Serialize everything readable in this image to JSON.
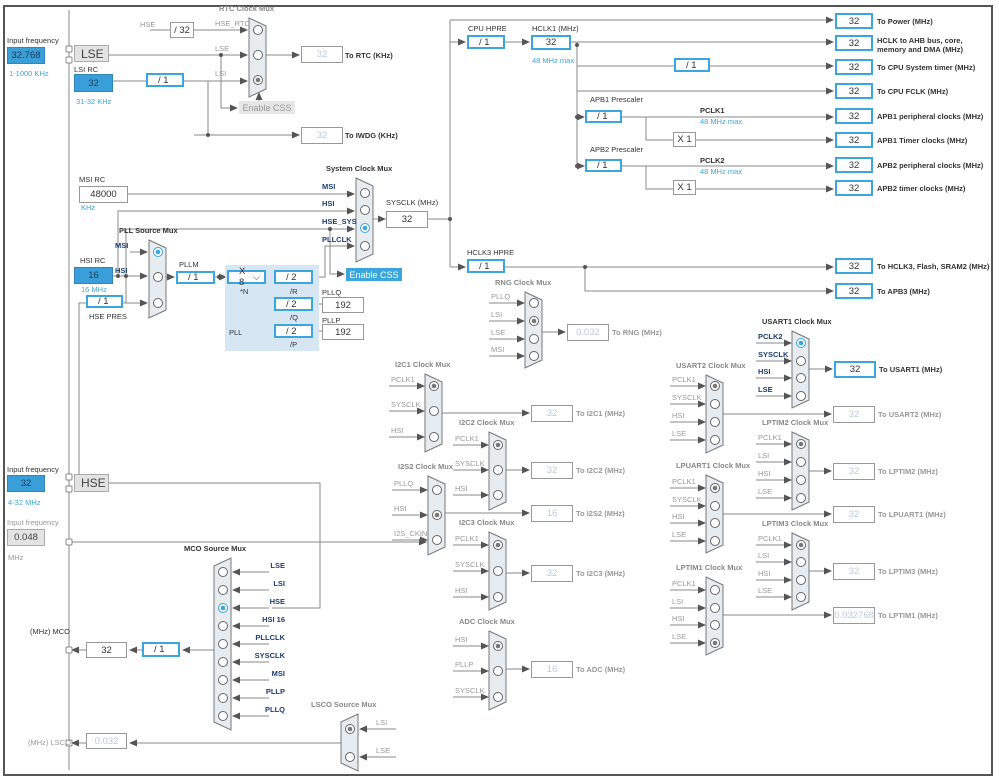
{
  "inputs": {
    "lse_freq": {
      "label": "Input frequency",
      "value": "32.768",
      "range": "1-1000 KHz"
    },
    "lse": "LSE",
    "lsi_rc": {
      "label": "LSI RC",
      "value": "32",
      "range": "31-32 KHz"
    },
    "msi_rc": {
      "label": "MSI RC",
      "value": "48000",
      "unit": "KHz"
    },
    "hsi_rc": {
      "label": "HSI RC",
      "value": "16",
      "range": "16 MHz"
    },
    "hse_freq": {
      "label": "Input frequency",
      "value": "32",
      "range": "4-32 MHz"
    },
    "hse": "HSE",
    "i2s_freq": {
      "label": "Input frequency",
      "value": "0.048",
      "unit": "MHz"
    }
  },
  "rtc": {
    "hse_label": "HSE",
    "hse_div": "/ 32",
    "lsi_div": "/ 1",
    "enable_css": "Enable CSS",
    "to_rtc": {
      "value": "32",
      "label": "To RTC (KHz)"
    },
    "to_iwdg": {
      "value": "32",
      "label": "To IWDG (KHz)"
    }
  },
  "pll": {
    "hse_pres": "/ 1",
    "hse_pres_label": "HSE PRES",
    "pllm_label": "PLLM",
    "pllm": "/ 1",
    "n_mult": "X 8",
    "n_label": "*N",
    "r_div": "/ 2",
    "r_label": "/R",
    "q_div": "/ 2",
    "q_label": "/Q",
    "p_div": "/ 2",
    "p_label": "/P",
    "region_label": "PLL",
    "pllq_label": "PLLQ",
    "pllq": "192",
    "pllp_label": "PLLP",
    "pllp": "192",
    "enable_css": "Enable CSS"
  },
  "sysclk": {
    "label": "SYSCLK (MHz)",
    "value": "32"
  },
  "bus": {
    "cpu_hpre_label": "CPU HPRE",
    "cpu_hpre": "/ 1",
    "hclk1_label": "HCLK1 (MHz)",
    "hclk1": "32",
    "hclk1_max": "48 MHz max",
    "systick_div": "/ 1",
    "apb1_label": "APB1 Prescaler",
    "apb1": "/ 1",
    "pclk1_label": "PCLK1",
    "pclk1_max": "48 MHz max",
    "apb1_timer_mult": "X 1",
    "apb2_label": "APB2 Prescaler",
    "apb2": "/ 1",
    "pclk2_label": "PCLK2",
    "pclk2_max": "48 MHz max",
    "apb2_timer_mult": "X 1",
    "hclk3_label": "HCLK3 HPRE",
    "hclk3": "/ 1"
  },
  "bus_outputs": [
    {
      "value": "32",
      "label": "To Power (MHz)"
    },
    {
      "value": "32",
      "label": "HCLK to AHB bus, core, memory and DMA (MHz)"
    },
    {
      "value": "32",
      "label": "To CPU System timer (MHz)"
    },
    {
      "value": "32",
      "label": "To CPU FCLK (MHz)"
    },
    {
      "value": "32",
      "label": "APB1 peripheral clocks (MHz)"
    },
    {
      "value": "32",
      "label": "APB1 Timer clocks (MHz)"
    },
    {
      "value": "32",
      "label": "APB2 peripheral clocks (MHz)"
    },
    {
      "value": "32",
      "label": "APB2 timer clocks (MHz)"
    },
    {
      "value": "32",
      "label": "To HCLK3, Flash, SRAM2 (MHz)"
    },
    {
      "value": "32",
      "label": "To APB3 (MHz)"
    }
  ],
  "muxes": {
    "rtc": {
      "title": "RTC Clock Mux",
      "inputs": [
        "HSE_RTC",
        "LSE",
        "LSI"
      ],
      "selected": 2,
      "active": false
    },
    "sys": {
      "title": "System Clock Mux",
      "inputs": [
        "MSI",
        "HSI",
        "HSE_SYS",
        "PLLCLK"
      ],
      "selected": 2,
      "active": true
    },
    "pllsrc": {
      "title": "PLL Source Mux",
      "inputs": [
        "MSI",
        "HSI",
        ""
      ],
      "selected": 0,
      "active": true
    },
    "rng": {
      "title": "RNG Clock Mux",
      "inputs": [
        "PLLQ",
        "LSI",
        "LSE",
        "MSI"
      ],
      "selected": 1,
      "active": false,
      "output": {
        "value": "0.032",
        "label": "To RNG (MHz)"
      }
    },
    "i2c1": {
      "title": "I2C1 Clock Mux",
      "inputs": [
        "PCLK1",
        "SYSCLK",
        "HSI"
      ],
      "selected": 0,
      "active": false,
      "output": {
        "value": "32",
        "label": "To I2C1 (MHz)"
      }
    },
    "i2c2": {
      "title": "I2C2 Clock Mux",
      "inputs": [
        "PCLK1",
        "SYSCLK",
        "HSI"
      ],
      "selected": 0,
      "active": false,
      "output": {
        "value": "32",
        "label": "To I2C2 (MHz)"
      }
    },
    "i2s2": {
      "title": "I2S2 Clock Mux",
      "inputs": [
        "PLLQ",
        "HSI",
        "I2S_CKIN"
      ],
      "selected": 1,
      "active": false,
      "output": {
        "value": "16",
        "label": "To I2S2 (MHz)"
      }
    },
    "i2c3": {
      "title": "I2C3 Clock Mux",
      "inputs": [
        "PCLK1",
        "SYSCLK",
        "HSI"
      ],
      "selected": 0,
      "active": false,
      "output": {
        "value": "32",
        "label": "To I2C3 (MHz)"
      }
    },
    "adc": {
      "title": "ADC Clock Mux",
      "inputs": [
        "HSI",
        "PLLP",
        "SYSCLK"
      ],
      "selected": 0,
      "active": false,
      "output": {
        "value": "16",
        "label": "To ADC (MHz)"
      }
    },
    "usart1": {
      "title": "USART1 Clock Mux",
      "inputs": [
        "PCLK2",
        "SYSCLK",
        "HSI",
        "LSE"
      ],
      "selected": 0,
      "active": true,
      "output": {
        "value": "32",
        "label": "To USART1 (MHz)"
      }
    },
    "usart2": {
      "title": "USART2 Clock Mux",
      "inputs": [
        "PCLK1",
        "SYSCLK",
        "HSI",
        "LSE"
      ],
      "selected": 0,
      "active": false,
      "output": {
        "value": "32",
        "label": "To USART2 (MHz)"
      }
    },
    "lptim2": {
      "title": "LPTIM2 Clock Mux",
      "inputs": [
        "PCLK1",
        "LSI",
        "HSI",
        "LSE"
      ],
      "selected": 0,
      "active": false,
      "output": {
        "value": "32",
        "label": "To LPTIM2 (MHz)"
      }
    },
    "lpuart1": {
      "title": "LPUART1 Clock Mux",
      "inputs": [
        "PCLK1",
        "SYSCLK",
        "HSI",
        "LSE"
      ],
      "selected": 0,
      "active": false,
      "output": {
        "value": "32",
        "label": "To LPUART1 (MHz)"
      }
    },
    "lptim3": {
      "title": "LPTIM3 Clock Mux",
      "inputs": [
        "PCLK1",
        "LSI",
        "HSI",
        "LSE"
      ],
      "selected": 0,
      "active": false,
      "output": {
        "value": "32",
        "label": "To LPTIM3 (MHz)"
      }
    },
    "lptim1": {
      "title": "LPTIM1 Clock Mux",
      "inputs": [
        "PCLK1",
        "LSI",
        "HSI",
        "LSE"
      ],
      "selected": 3,
      "active": false,
      "output": {
        "value": "0.032768",
        "label": "To LPTIM1 (MHz)"
      }
    },
    "mco": {
      "title": "MCO Source Mux",
      "inputs": [
        "LSE",
        "LSI",
        "HSE",
        "HSI 16",
        "PLLCLK",
        "SYSCLK",
        "MSI",
        "PLLP",
        "PLLQ"
      ],
      "selected": 2,
      "active": true
    },
    "lsco": {
      "title": "LSCO Source Mux",
      "inputs": [
        "LSI",
        "LSE"
      ],
      "selected": 0,
      "active": false
    }
  },
  "mco": {
    "label": "(MHz) MCO",
    "value": "32",
    "div": "/ 1"
  },
  "lsco": {
    "label": "(MHz) LSCO",
    "value": "0.032"
  },
  "colors": {
    "accent": "#3aa6dd",
    "input_fill": "#3a9fd8",
    "pll_region": "#d6e6f3",
    "mux_fill": "#e6ecf0"
  }
}
